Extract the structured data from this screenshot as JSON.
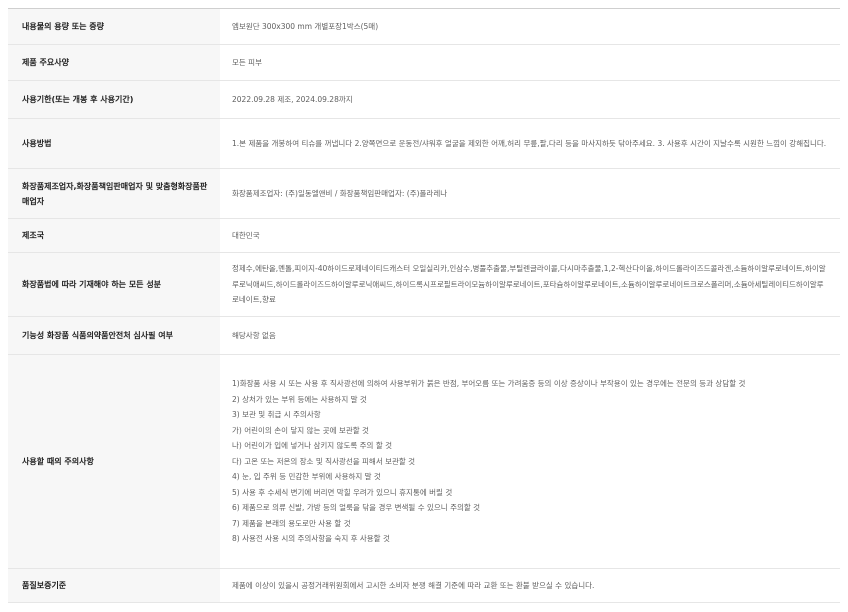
{
  "rows": [
    {
      "label": "내용물의 용량 또는 중량",
      "value": "엠보원단 300x300 mm 개별포장1박스(5매)"
    },
    {
      "label": "제품 주요사양",
      "value": "모든 피부"
    },
    {
      "label": "사용기한(또는 개봉 후 사용기간)",
      "value": "2022.09.28 제조, 2024.09.28까지"
    },
    {
      "label": "사용방법",
      "value": "1.본 제품을 개봉하여 티슈를 꺼냅니다 2.양쪽면으로 운동전/샤워후 얼굴을 제외한 어깨,허리 무릎,팔,다리 등을 마사지하듯 닦아주세요. 3. 사용후 시간이 지날수록 시원한 느낌이 강해집니다."
    },
    {
      "label": "화장품제조업자,화장품책임판매업자 및 맞춤형화장품판매업자",
      "value": "화장품제조업자: (주)일동엘앤비 / 화장품책임판매업자: (주)폴라레나"
    },
    {
      "label": "제조국",
      "value": "대한민국"
    },
    {
      "label": "화장품법에 따라 기재해야 하는 모든 성분",
      "value": "정제수,에탄올,멘톨,피이지-40하이드로제네이티드캐스터 오일실리카,인삼수,병풀추출물,부틸렌글라이콜,다시마추출물,1,2-헥산다이올,하이드롤라이즈드콜라겐,소듐하이알루로네이트,하이알루로닉애씨드,하이드롤라이즈드하이알루로닉애씨드,하이드록시프로필트라이모늄하이알루로네이트,포타슘하이알루로네이트,소듐하이알루로네이트크로스폴리머,소듐아세틸레이티드하이알루로네이트,향료"
    },
    {
      "label": "기능성 화장품 식품의약품안전처 심사필 여부",
      "value": "해당사항 없음"
    },
    {
      "label": "사용할 때의 주의사항",
      "lines": [
        "1)화장품 사용 시 또는 사용 후 직사광선에 의하여 사용부위가 붉은 반점, 부어오름 또는 가려움증 등의 이상 증상이나 부작용이 있는 경우에는 전문의 등과 상담할 것",
        "2) 상처가 있는 부위 등에는 사용하지 말 것",
        "3) 보관 및 취급 시 주의사항",
        "가) 어린이의 손이 닿지 않는 곳에 보관할 것",
        "나) 어린이가 입에 넣거나 삼키지 않도록 주의 할 것",
        "다) 고온 또는 저온의 장소 및 직사광선을 피해서 보관할 것",
        "4) 눈, 입 주위 등 민감한 부위에 사용하지 말 것",
        "5) 사용 후 수세식 변기에 버리면 막힐 우려가 있으니 휴지통에 버릴 것",
        "6) 제품으로 의류 신발, 가방 등의 얼룩을 닦을 경우 변색될 수 있으니 주의할 것",
        "7) 제품을 본래의 용도로만 사용 할 것",
        "8) 사용전 사용 시의 주의사항을 숙지 후 사용할 것"
      ]
    },
    {
      "label": "품질보증기준",
      "value": "제품에 이상이 있을시 공정거래위원회에서 고시한 소비자 분쟁 해결 기준에 따라 교환 또는 환불 받으실 수 있습니다."
    }
  ]
}
